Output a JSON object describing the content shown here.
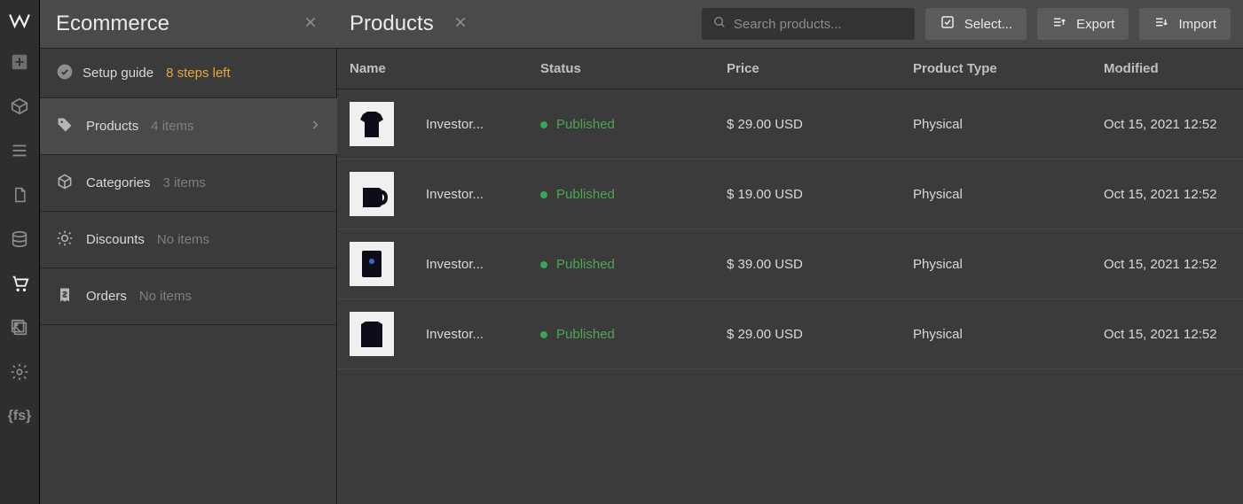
{
  "sidebar": {
    "title": "Ecommerce",
    "setup_label": "Setup guide",
    "setup_steps": "8 steps left",
    "items": [
      {
        "label": "Products",
        "count": "4 items"
      },
      {
        "label": "Categories",
        "count": "3 items"
      },
      {
        "label": "Discounts",
        "count": "No items"
      },
      {
        "label": "Orders",
        "count": "No items"
      }
    ]
  },
  "main": {
    "title": "Products",
    "search_placeholder": "Search products...",
    "buttons": {
      "select": "Select...",
      "export": "Export",
      "import": "Import"
    },
    "columns": {
      "name": "Name",
      "status": "Status",
      "price": "Price",
      "type": "Product Type",
      "modified": "Modified"
    },
    "rows": [
      {
        "name": "Investor...",
        "status": "Published",
        "price": "$ 29.00 USD",
        "type": "Physical",
        "modified": "Oct 15, 2021 12:52"
      },
      {
        "name": "Investor...",
        "status": "Published",
        "price": "$ 19.00 USD",
        "type": "Physical",
        "modified": "Oct 15, 2021 12:52"
      },
      {
        "name": "Investor...",
        "status": "Published",
        "price": "$ 39.00 USD",
        "type": "Physical",
        "modified": "Oct 15, 2021 12:52"
      },
      {
        "name": "Investor...",
        "status": "Published",
        "price": "$ 29.00 USD",
        "type": "Physical",
        "modified": "Oct 15, 2021 12:52"
      }
    ]
  }
}
